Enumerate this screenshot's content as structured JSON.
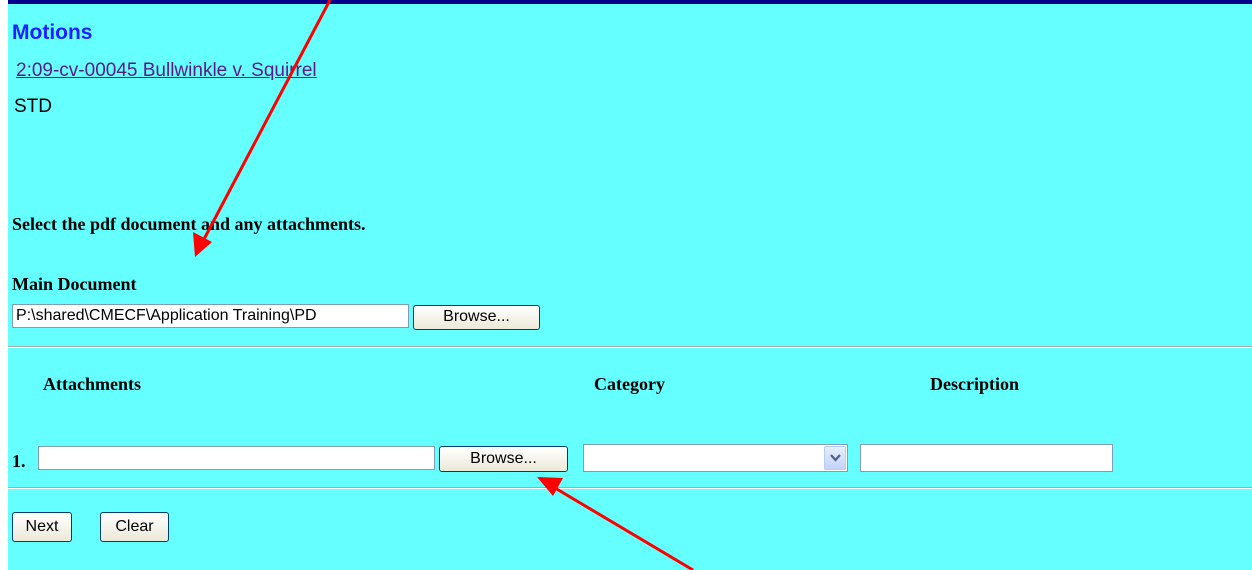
{
  "page": {
    "title": "Motions",
    "case_link": "2:09-cv-00045 Bullwinkle v. Squirrel",
    "office": "STD",
    "instructions": "Select the pdf document and any attachments."
  },
  "main_document": {
    "label": "Main Document",
    "file_value": "P:\\shared\\CMECF\\Application Training\\PD",
    "browse_label": "Browse..."
  },
  "attachments": {
    "headers": {
      "attachments": "Attachments",
      "category": "Category",
      "description": "Description"
    },
    "rows": [
      {
        "number": "1.",
        "file_value": "",
        "browse_label": "Browse...",
        "category_selected": "",
        "description_value": ""
      }
    ]
  },
  "actions": {
    "next_label": "Next",
    "clear_label": "Clear"
  },
  "colors": {
    "background": "#66ffff",
    "title": "#1f1fff",
    "link": "#5a1a8c",
    "annotation_arrow": "#ff0000"
  },
  "icons": [
    "dropdown-chevron-icon",
    "annotation-arrow"
  ]
}
